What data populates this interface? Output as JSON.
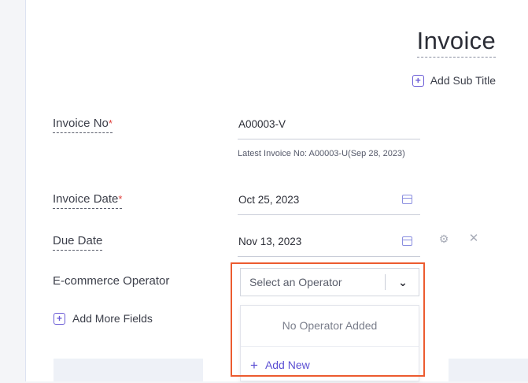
{
  "invoice": {
    "title": "Invoice",
    "add_subtitle_label": "Add Sub Title"
  },
  "fields": {
    "invoice_no": {
      "label": "Invoice No",
      "required_mark": "*",
      "value": "A00003-V",
      "hint": "Latest Invoice No: A00003-U(Sep 28, 2023)"
    },
    "invoice_date": {
      "label": "Invoice Date",
      "required_mark": "*",
      "value": "Oct 25, 2023"
    },
    "due_date": {
      "label": "Due Date",
      "value": "Nov 13, 2023"
    },
    "ecommerce_operator": {
      "label": "E-commerce Operator",
      "placeholder": "Select an Operator"
    }
  },
  "dropdown": {
    "empty_text": "No Operator Added",
    "add_new_label": "Add New"
  },
  "add_more_fields_label": "Add More Fields",
  "colors": {
    "accent": "#6a5bd6",
    "required": "#e0413d",
    "highlight_border": "#ec5b2f"
  },
  "icons": {
    "plus": "plus-square-icon",
    "calendar": "calendar-icon",
    "settings": "gear-icon",
    "close": "close-icon",
    "chevron": "chevron-down-icon"
  }
}
